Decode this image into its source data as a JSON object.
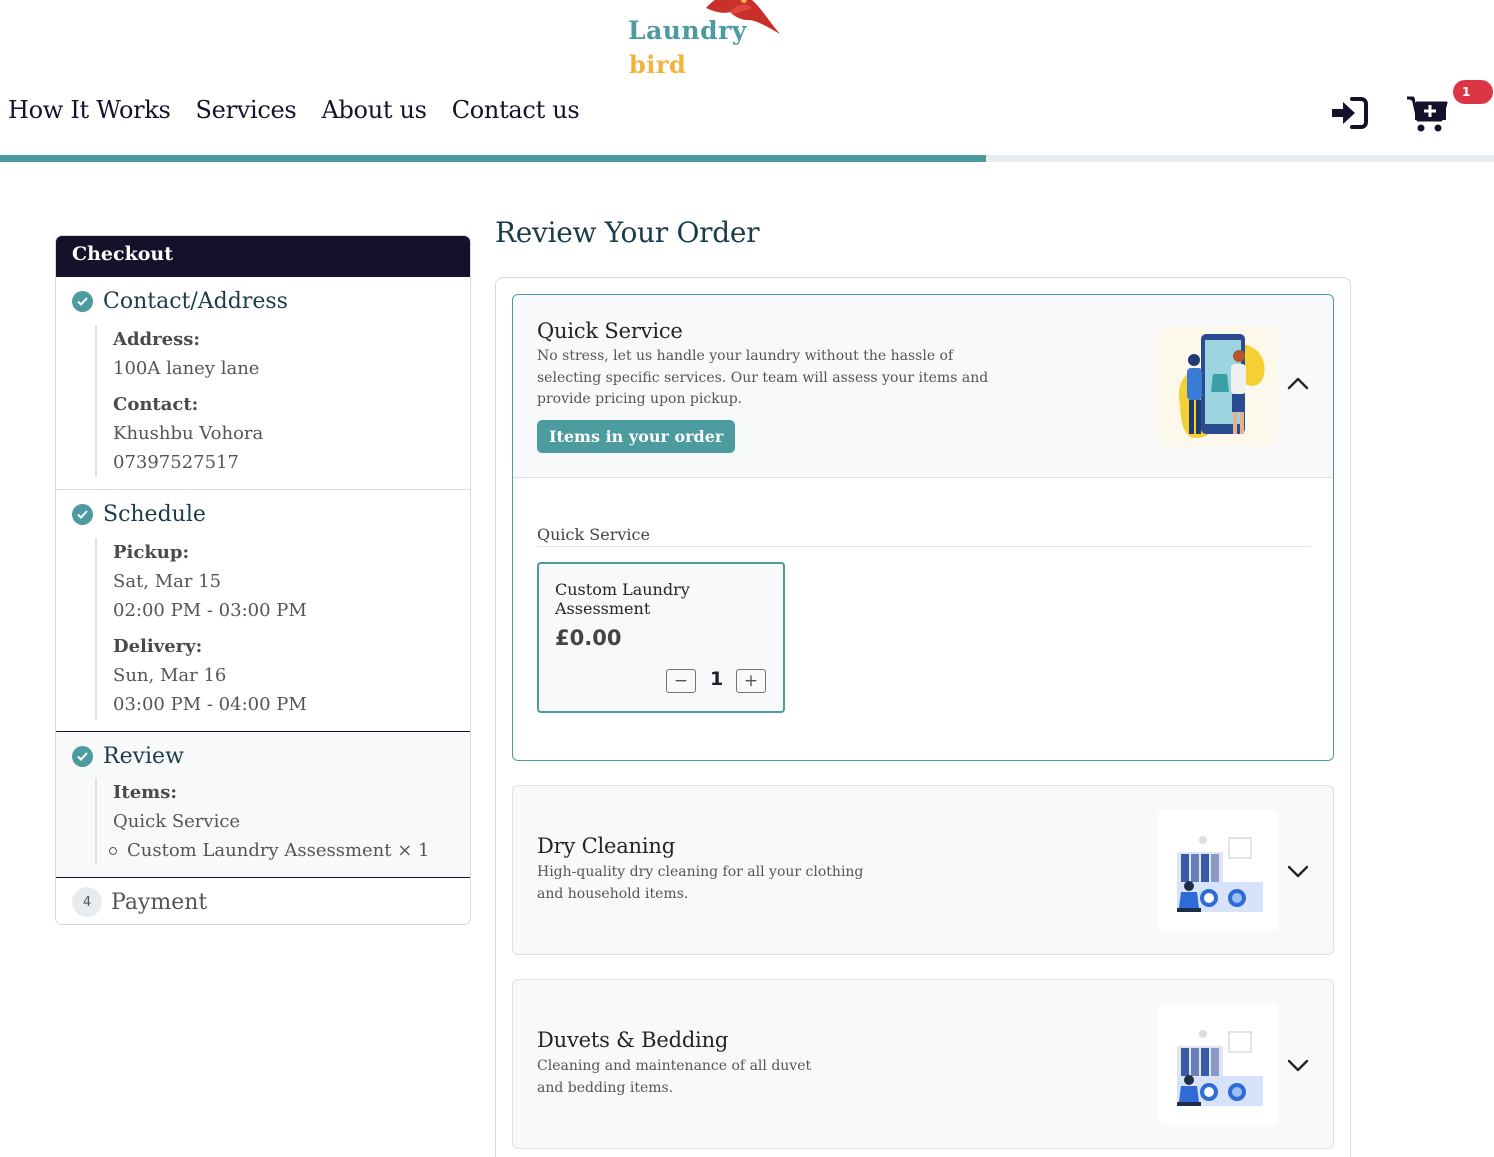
{
  "logo": {
    "line1": "Laundry",
    "line2": "bird"
  },
  "nav": {
    "items": [
      {
        "label": "How It Works"
      },
      {
        "label": "Services"
      },
      {
        "label": "About us"
      },
      {
        "label": "Contact us"
      }
    ]
  },
  "cart": {
    "count": "1"
  },
  "progress": {
    "fraction": 0.66
  },
  "colors": {
    "accent": "#4c9b9f",
    "dark": "#14122a",
    "badge": "#dc3545"
  },
  "checkout": {
    "title": "Checkout",
    "contact": {
      "title": "Contact/Address",
      "address_label": "Address:",
      "address": "100A laney lane",
      "contact_label": "Contact:",
      "name": "Khushbu Vohora",
      "phone": "07397527517"
    },
    "schedule": {
      "title": "Schedule",
      "pickup_label": "Pickup:",
      "pickup_date": "Sat, Mar 15",
      "pickup_time": "02:00 PM - 03:00 PM",
      "delivery_label": "Delivery:",
      "delivery_date": "Sun, Mar 16",
      "delivery_time": "03:00 PM - 04:00 PM"
    },
    "review": {
      "title": "Review",
      "items_label": "Items:",
      "service": "Quick Service",
      "item_line": "Custom Laundry Assessment × 1"
    },
    "payment": {
      "number": "4",
      "title": "Payment"
    }
  },
  "main": {
    "title": "Review Your Order",
    "services": [
      {
        "title": "Quick Service",
        "desc_lines": [
          "No stress, let us handle your laundry without the hassle of",
          "selecting specific services. Our team will assess your items and",
          "provide pricing upon pickup."
        ],
        "button": "Items in your order",
        "icon": "chevron-up-icon"
      },
      {
        "title": "Dry Cleaning",
        "desc_lines": [
          "High-quality dry cleaning for all your clothing",
          "and household items."
        ],
        "icon": "chevron-down-icon"
      },
      {
        "title": "Duvets & Bedding",
        "desc_lines": [
          "Cleaning and maintenance of all duvet",
          "and bedding items."
        ],
        "icon": "chevron-down-icon"
      }
    ],
    "section_title": "Quick Service",
    "item": {
      "name": "Custom Laundry Assessment",
      "price": "£0.00",
      "qty": "1",
      "minus": "−",
      "plus": "+"
    }
  }
}
